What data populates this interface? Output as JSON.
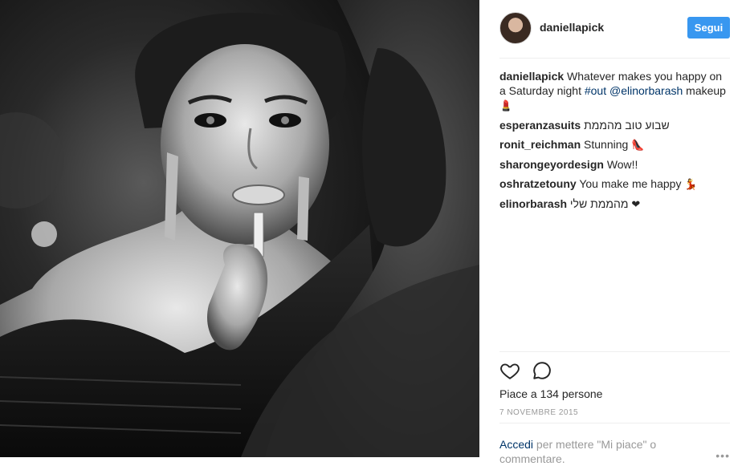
{
  "post": {
    "username": "daniellapick",
    "follow_label": "Segui"
  },
  "caption": {
    "user": "daniellapick",
    "text_1": " Whatever makes you happy on a Saturday night ",
    "hashtag": "#out",
    "mention": "@elinorbarash",
    "text_2": " makeup ",
    "emoji": "💄"
  },
  "comments": [
    {
      "user": "esperanzasuits",
      "text": "שבוע טוב מהממת",
      "emoji": ""
    },
    {
      "user": "ronit_reichman",
      "text": "Stunning",
      "emoji": "👠"
    },
    {
      "user": "sharongeyordesign",
      "text": "Wow!!",
      "emoji": ""
    },
    {
      "user": "oshratzetouny",
      "text": "You make me happy",
      "emoji": "💃"
    },
    {
      "user": "elinorbarash",
      "text": "מהממת שלי",
      "emoji": "❤"
    }
  ],
  "likes": "Piace a 134 persone",
  "date": "7 NOVEMBRE 2015",
  "login": {
    "link": "Accedi",
    "text": " per mettere \"Mi piace\" o commentare."
  },
  "more": "•••",
  "icons": {
    "like": "heart-outline-icon",
    "comment": "speech-bubble-icon"
  },
  "colors": {
    "accent": "#3897f0",
    "link": "#003569",
    "muted": "#999999",
    "divider": "#efefef"
  }
}
